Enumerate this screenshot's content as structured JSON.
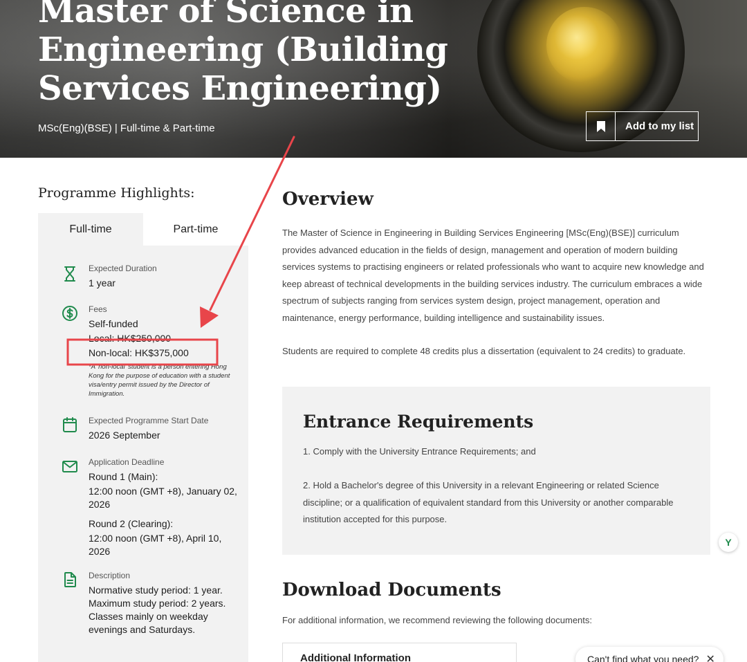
{
  "hero": {
    "title": "Master of Science in Engineering (Building Services Engineering)",
    "subtitle": "MSc(Eng)(BSE) | Full-time & Part-time",
    "add_to_list_label": "Add to my list"
  },
  "highlights": {
    "heading": "Programme Highlights:",
    "tabs": [
      {
        "label": "Full-time",
        "active": true
      },
      {
        "label": "Part-time",
        "active": false
      }
    ],
    "duration": {
      "icon": "hourglass-icon",
      "label": "Expected Duration",
      "value": "1 year"
    },
    "fees": {
      "icon": "dollar-icon",
      "label": "Fees",
      "funding": "Self-funded",
      "local": "Local: HK$250,000",
      "nonlocal": "Non-local: HK$375,000",
      "note": "*A 'non-local' student is a person entering Hong Kong for the purpose of education with a student visa/entry permit issued by the Director of Immigration."
    },
    "start_date": {
      "icon": "calendar-icon",
      "label": "Expected Programme Start Date",
      "value": "2026 September"
    },
    "deadline": {
      "icon": "envelope-icon",
      "label": "Application Deadline",
      "round1_title": "Round 1 (Main):",
      "round1_date": "12:00 noon (GMT +8), January 02, 2026",
      "round2_title": "Round 2 (Clearing):",
      "round2_date": "12:00 noon (GMT +8), April 10, 2026"
    },
    "description": {
      "icon": "document-icon",
      "label": "Description",
      "value": "Normative study period: 1 year. Maximum study period: 2 years. Classes mainly on weekday evenings and Saturdays."
    }
  },
  "overview": {
    "heading": "Overview",
    "paragraph1": "The Master of Science in Engineering in Building Services Engineering [MSc(Eng)(BSE)] curriculum provides advanced education in the fields of design, management and operation of modern building services systems to practising engineers or related professionals who want to acquire new knowledge and keep abreast of technical developments in the building services industry. The curriculum embraces a wide spectrum of subjects ranging from services system design, project management, operation and maintenance, energy performance, building intelligence and sustainability issues.",
    "paragraph2": "Students are required to complete 48 credits plus a dissertation (equivalent to 24 credits) to graduate."
  },
  "entrance": {
    "heading": "Entrance Requirements",
    "item1": "1. Comply with the University Entrance Requirements; and",
    "item2": "2. Hold a Bachelor's degree of this University in a relevant Engineering or related Science discipline; or a qualification of equivalent standard from this University or another comparable institution accepted for this purpose."
  },
  "downloads": {
    "heading": "Download Documents",
    "intro": "For additional information, we recommend reviewing the following documents:",
    "card_title": "Additional Information"
  },
  "widgets": {
    "badge_letter": "Y",
    "help_text": "Can't find what you need?",
    "help_close": "✕"
  },
  "colors": {
    "accent_green": "#1f8a4c",
    "panel_bg": "#f2f2f2",
    "annotation_red": "#e8454a"
  }
}
